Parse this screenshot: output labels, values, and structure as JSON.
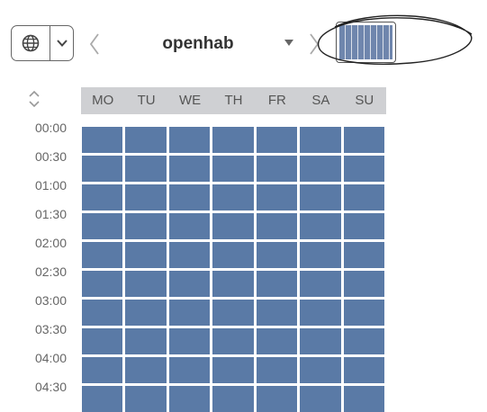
{
  "toolbar": {
    "device_name": "openhab",
    "language_icon": "globe-icon",
    "dropdown_icon": "chevron-down-icon",
    "prev_icon": "chevron-left-icon",
    "next_icon": "chevron-right-icon",
    "device_caret_icon": "caret-down-icon"
  },
  "schedule": {
    "days": [
      "MO",
      "TU",
      "WE",
      "TH",
      "FR",
      "SA",
      "SU"
    ],
    "times": [
      "00:00",
      "00:30",
      "01:00",
      "01:30",
      "02:00",
      "02:30",
      "03:00",
      "03:30",
      "04:00",
      "04:30"
    ],
    "cell_color": "#5a7aa6",
    "header_bg": "#cfd0d3"
  }
}
